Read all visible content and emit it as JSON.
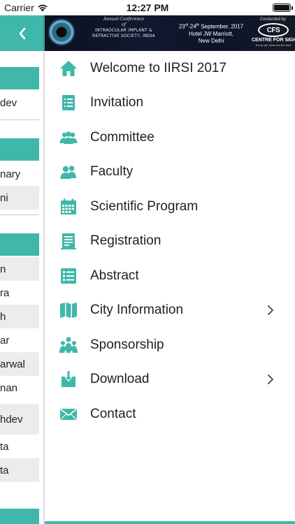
{
  "status_bar": {
    "carrier": "Carrier",
    "time": "12:27 PM",
    "wifi_icon": "wifi-icon",
    "battery_level": 1.0
  },
  "back_screen": {
    "back_icon": "chevron-left-icon",
    "rows": [
      "dev",
      "nary",
      "ni",
      "n",
      "ra",
      "h",
      "ar",
      "arwal",
      "nan",
      "hdev",
      "ta",
      "ta"
    ]
  },
  "banner": {
    "line1": "Annual Conference",
    "line2": "of",
    "line3": "INTRAOCULAR IMPLANT &",
    "line4": "REFRACTIVE SOCIETY, INDIA",
    "date_day1": "23",
    "date_sup1": "rd",
    "date_sep": "-24",
    "date_sup2": "th",
    "date_rest": " September, 2017",
    "venue1": "Hotel JW Marriott,",
    "venue2": "New Delhi",
    "conducted_by": "Conducted by:",
    "logo_mark": "CFS",
    "logo_name": "CENTRE FOR SIGHT",
    "logo_tagline": "Every eye deserves the best"
  },
  "menu": {
    "items": [
      {
        "label": "Welcome to IIRSI 2017",
        "icon": "home-icon",
        "has_submenu": false
      },
      {
        "label": "Invitation",
        "icon": "list-icon",
        "has_submenu": false
      },
      {
        "label": "Committee",
        "icon": "group-icon",
        "has_submenu": false
      },
      {
        "label": "Faculty",
        "icon": "users-icon",
        "has_submenu": false
      },
      {
        "label": "Scientific Program",
        "icon": "calendar-icon",
        "has_submenu": false
      },
      {
        "label": "Registration",
        "icon": "form-icon",
        "has_submenu": false
      },
      {
        "label": "Abstract",
        "icon": "abstract-icon",
        "has_submenu": false
      },
      {
        "label": "City Information",
        "icon": "map-icon",
        "has_submenu": true
      },
      {
        "label": "Sponsorship",
        "icon": "sponsor-icon",
        "has_submenu": false
      },
      {
        "label": "Download",
        "icon": "download-icon",
        "has_submenu": true
      },
      {
        "label": "Contact",
        "icon": "mail-icon",
        "has_submenu": false
      }
    ]
  },
  "colors": {
    "accent": "#3fb7aa",
    "text": "#1f1f1f",
    "chevron": "#444444"
  }
}
